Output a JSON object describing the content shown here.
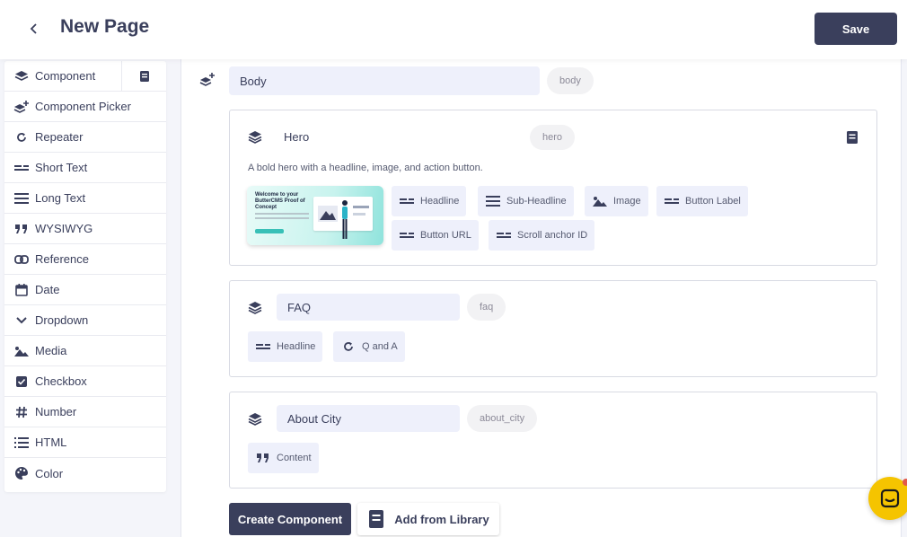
{
  "header": {
    "back_icon": "chevron-left-icon",
    "title": "New Page",
    "save_label": "Save"
  },
  "sidebar": {
    "items": [
      {
        "label": "Component",
        "icon": "layers-icon"
      },
      {
        "label": "Component Picker",
        "icon": "layers-plus-icon"
      },
      {
        "label": "Repeater",
        "icon": "refresh-icon"
      },
      {
        "label": "Short Text",
        "icon": "short-text-icon"
      },
      {
        "label": "Long Text",
        "icon": "long-text-icon"
      },
      {
        "label": "WYSIWYG",
        "icon": "quote-icon"
      },
      {
        "label": "Reference",
        "icon": "link-icon"
      },
      {
        "label": "Date",
        "icon": "calendar-icon"
      },
      {
        "label": "Dropdown",
        "icon": "chevron-down-icon"
      },
      {
        "label": "Media",
        "icon": "image-icon"
      },
      {
        "label": "Checkbox",
        "icon": "checkbox-icon"
      },
      {
        "label": "Number",
        "icon": "hash-icon"
      },
      {
        "label": "HTML",
        "icon": "list-icon"
      },
      {
        "label": "Color",
        "icon": "palette-icon"
      }
    ],
    "library_icon": "book-icon"
  },
  "body_section": {
    "name": "Body",
    "slug": "body"
  },
  "components": {
    "hero": {
      "name": "Hero",
      "slug": "hero",
      "description": "A bold hero with a headline, image, and action button.",
      "thumbnail_text": "Welcome to your ButterCMS Proof of Concept",
      "fields": [
        {
          "label": "Headline",
          "icon": "short-text-icon"
        },
        {
          "label": "Sub-Headline",
          "icon": "long-text-icon"
        },
        {
          "label": "Image",
          "icon": "image-icon"
        },
        {
          "label": "Button Label",
          "icon": "short-text-icon"
        },
        {
          "label": "Button URL",
          "icon": "short-text-icon"
        },
        {
          "label": "Scroll anchor ID",
          "icon": "short-text-icon"
        }
      ]
    },
    "faq": {
      "name": "FAQ",
      "slug": "faq",
      "fields": [
        {
          "label": "Headline",
          "icon": "short-text-icon"
        },
        {
          "label": "Q and A",
          "icon": "refresh-icon"
        }
      ]
    },
    "about_city": {
      "name": "About City",
      "slug": "about_city",
      "fields": [
        {
          "label": "Content",
          "icon": "quote-icon"
        }
      ]
    }
  },
  "actions": {
    "create_component": "Create Component",
    "add_from_library": "Add from Library"
  },
  "colors": {
    "primary": "#3a3f5c",
    "chip_bg": "#eef0fb",
    "chat_accent": "#f5c400"
  }
}
